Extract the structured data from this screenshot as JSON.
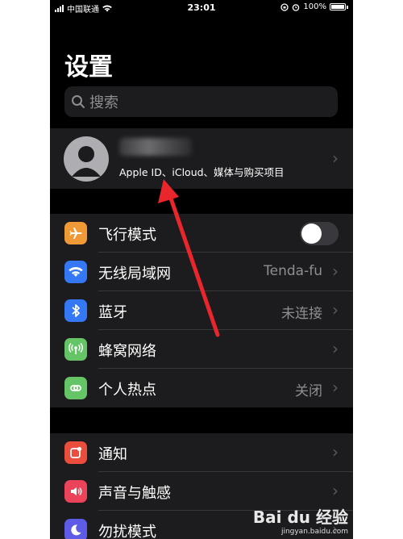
{
  "status": {
    "carrier": "中国联通",
    "time": "23:01",
    "battery": "100%"
  },
  "title": "设置",
  "search": {
    "placeholder": "搜索"
  },
  "profile": {
    "subtitle": "Apple ID、iCloud、媒体与购买项目"
  },
  "group1": [
    {
      "label": "飞行模式",
      "icon": "airplane-icon",
      "color": "#f09a37",
      "toggle": false
    },
    {
      "label": "无线局域网",
      "icon": "wifi-icon",
      "color": "#3478f6",
      "value": "Tenda-fu"
    },
    {
      "label": "蓝牙",
      "icon": "bluetooth-icon",
      "color": "#3478f6",
      "value": "未连接"
    },
    {
      "label": "蜂窝网络",
      "icon": "cellular-icon",
      "color": "#65c466"
    },
    {
      "label": "个人热点",
      "icon": "hotspot-icon",
      "color": "#65c466",
      "value": "关闭"
    }
  ],
  "group2": [
    {
      "label": "通知",
      "icon": "notifications-icon",
      "color": "#eb4e3d"
    },
    {
      "label": "声音与触感",
      "icon": "sounds-icon",
      "color": "#eb445a"
    },
    {
      "label": "勿扰模式",
      "icon": "moon-icon",
      "color": "#5e5ce6"
    }
  ],
  "watermark": {
    "brand": "Bai du 经验",
    "url": "jingyan.baidu.com"
  }
}
